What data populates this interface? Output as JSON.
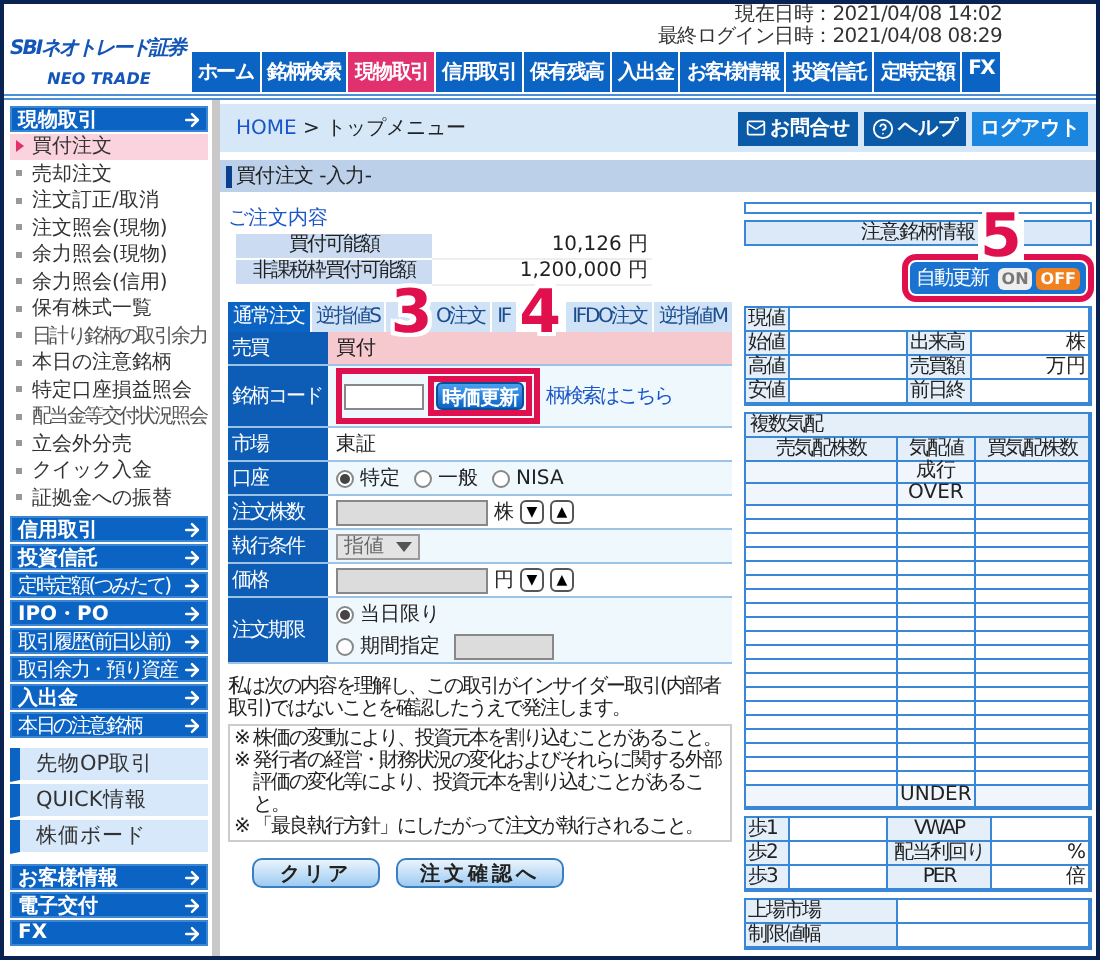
{
  "logo": {
    "brand": "SBIネオトレード証券",
    "product": "NEO TRADE"
  },
  "clock": {
    "current": "現在日時：2021/04/08 14:02",
    "last_login": "最終ログイン日時：2021/04/08 08:29"
  },
  "nav": [
    {
      "label": "ホーム",
      "selected": false
    },
    {
      "label": "銘柄検索",
      "selected": false
    },
    {
      "label": "現物取引",
      "selected": true
    },
    {
      "label": "信用取引",
      "selected": false
    },
    {
      "label": "保有残高",
      "selected": false
    },
    {
      "label": "入出金",
      "selected": false
    },
    {
      "label": "お客様情報",
      "selected": false
    },
    {
      "label": "投資信託",
      "selected": false
    },
    {
      "label": "定時定額",
      "selected": false
    },
    {
      "label": "FX",
      "selected": false
    }
  ],
  "sidebar": [
    {
      "kind": "header",
      "label": "現物取引",
      "selected": false
    },
    {
      "kind": "item",
      "label": "買付注文",
      "selected": true
    },
    {
      "kind": "item",
      "label": "売却注文",
      "selected": false
    },
    {
      "kind": "item",
      "label": "注文訂正/取消",
      "selected": false
    },
    {
      "kind": "item",
      "label": "注文照会(現物)",
      "selected": false
    },
    {
      "kind": "item",
      "label": "余力照会(現物)",
      "selected": false
    },
    {
      "kind": "item",
      "label": "余力照会(信用)",
      "selected": false
    },
    {
      "kind": "item",
      "label": "保有株式一覧",
      "selected": false
    },
    {
      "kind": "small_item",
      "label": "日計り銘柄の取引余力",
      "selected": false
    },
    {
      "kind": "item",
      "label": "本日の注意銘柄",
      "selected": false
    },
    {
      "kind": "item",
      "label": "特定口座損益照会",
      "selected": false
    },
    {
      "kind": "small_item",
      "label": "配当金等交付状況照会",
      "selected": false
    },
    {
      "kind": "item",
      "label": "立会外分売",
      "selected": false
    },
    {
      "kind": "item",
      "label": "クイック入金",
      "selected": false
    },
    {
      "kind": "item",
      "label": "証拠金への振替",
      "selected": false
    },
    {
      "kind": "header",
      "label": "信用取引",
      "selected": false
    },
    {
      "kind": "header",
      "label": "投資信託",
      "selected": false
    },
    {
      "kind": "header_compact",
      "label": "定時定額(つみたて)",
      "selected": false
    },
    {
      "kind": "header",
      "label": "IPO・PO",
      "selected": false
    },
    {
      "kind": "header_compact",
      "label": "取引履歴(前日以前)",
      "selected": false
    },
    {
      "kind": "header_compact",
      "label": "取引余力・預り資産",
      "selected": false
    },
    {
      "kind": "header",
      "label": "入出金",
      "selected": false
    },
    {
      "kind": "header_compact",
      "label": "本日の注意銘柄",
      "selected": false
    },
    {
      "kind": "panel",
      "label": "先物OP取引",
      "selected": false
    },
    {
      "kind": "panel",
      "label": "QUICK情報",
      "selected": false
    },
    {
      "kind": "panel",
      "label": "株価ボード",
      "selected": false
    },
    {
      "kind": "header",
      "label": "お客様情報",
      "selected": false
    },
    {
      "kind": "header",
      "label": "電子交付",
      "selected": false
    },
    {
      "kind": "header",
      "label": "FX",
      "selected": false
    }
  ],
  "breadcrumb": {
    "home": "HOME",
    "separator": ">",
    "current": "トップメニュー"
  },
  "actions": [
    {
      "kind": "mail",
      "label": "お問合せ"
    },
    {
      "kind": "help",
      "label": "ヘルプ"
    },
    {
      "kind": "plain",
      "label": "ログアウト"
    }
  ],
  "page_title": "買付注文 -入力-",
  "order_summary": {
    "title": "ご注文内容",
    "rows": [
      {
        "label": "買付可能額",
        "value": "10,126",
        "unit": "円"
      },
      {
        "label": "非課税枠買付可能額",
        "value": "1,200,000",
        "unit": "円"
      }
    ]
  },
  "order_tabs": [
    {
      "label": "通常注文",
      "selected": true
    },
    {
      "label": "逆指値S",
      "selected": false
    },
    {
      "label": "O注文",
      "selected": false
    },
    {
      "label": "IF",
      "selected": false
    },
    {
      "label": "IFDO注文",
      "selected": false
    },
    {
      "label": "逆指値M",
      "selected": false
    }
  ],
  "order_form": [
    {
      "kind": "side",
      "label": "売買",
      "value": "買付"
    },
    {
      "kind": "code",
      "label": "銘柄コード",
      "button": "時価更新",
      "link": "柄検索はこちら"
    },
    {
      "kind": "text",
      "label": "市場",
      "value": "東証"
    },
    {
      "kind": "radio",
      "label": "口座",
      "options": [
        {
          "label": "特定",
          "selected": true
        },
        {
          "label": "一般",
          "selected": false
        },
        {
          "label": "NISA",
          "selected": false
        }
      ]
    },
    {
      "kind": "stepper",
      "label": "注文株数",
      "unit": "株",
      "down": "▼",
      "up": "▲",
      "disabled": true
    },
    {
      "kind": "select",
      "label": "執行条件",
      "value": "指値",
      "disabled": true
    },
    {
      "kind": "stepper",
      "label": "価格",
      "unit": "円",
      "down": "▼",
      "up": "▲",
      "disabled": true
    },
    {
      "kind": "period",
      "label": "注文期限",
      "options": [
        {
          "label": "当日限り",
          "selected": true
        },
        {
          "label": "期間指定",
          "selected": false
        }
      ]
    }
  ],
  "disclaimer": {
    "intro": "私は次の内容を理解し、この取引がインサイダー取引(内部者取引)ではないことを確認したうえで発注します。",
    "notes": [
      {
        "mark": "※",
        "text": "株価の変動により、投資元本を割り込むことがあること。"
      },
      {
        "mark": "※",
        "text": "発行者の経営・財務状況の変化およびそれらに関する外部評価の変化等により、投資元本を割り込むことがあること。"
      },
      {
        "mark": "※",
        "text": "「最良執行方針」にしたがって注文が執行されること。"
      }
    ]
  },
  "form_buttons": [
    "クリア",
    "注文確認へ"
  ],
  "watch": {
    "title": "注意銘柄情報",
    "auto_update": {
      "label": "自動更新",
      "options": [
        {
          "label": "ON",
          "selected": false
        },
        {
          "label": "OFF",
          "selected": true
        }
      ]
    },
    "quote": [
      {
        "label": "現値"
      },
      {
        "label": "始値",
        "label2": "出来高",
        "unit": "株"
      },
      {
        "label": "高値",
        "label2": "売買額",
        "unit": "万円"
      },
      {
        "label": "安値",
        "label2": "前日終"
      }
    ],
    "board": {
      "title": "複数気配",
      "columns": [
        "売気配株数",
        "気配値",
        "買気配株数"
      ],
      "top": [
        "成行",
        "OVER"
      ],
      "bottom": "UNDER"
    },
    "stats": [
      {
        "label": "歩1",
        "label2": "VWAP"
      },
      {
        "label": "歩2",
        "label2": "配当利回り",
        "unit": "%"
      },
      {
        "label": "歩3",
        "label2": "PER",
        "unit": "倍"
      }
    ],
    "listing": [
      {
        "label": "上場市場"
      },
      {
        "label": "制限値幅"
      }
    ]
  },
  "annotations": [
    {
      "label": "3"
    },
    {
      "label": "4"
    },
    {
      "label": "5"
    }
  ]
}
